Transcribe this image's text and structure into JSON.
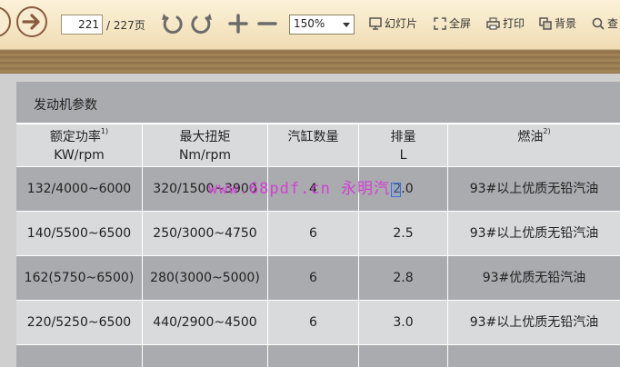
{
  "toolbar": {
    "page_current": "221",
    "page_total": "/ 227页",
    "zoom": "150%",
    "slideshow_label": "幻灯片",
    "fullscreen_label": "全屏",
    "print_label": "打印",
    "background_label": "背景",
    "search_label": "查"
  },
  "table": {
    "title": "发动机参数",
    "headers": [
      {
        "line1": "额定功率",
        "sup": "1)",
        "line2": "KW/rpm"
      },
      {
        "line1": "最大扭矩",
        "sup": "",
        "line2": "Nm/rpm"
      },
      {
        "line1": "汽缸数量",
        "sup": "",
        "line2": ""
      },
      {
        "line1": "排量",
        "sup": "",
        "line2": "L"
      },
      {
        "line1": "燃油",
        "sup": "2)",
        "line2": ""
      }
    ],
    "rows": [
      {
        "power": "132/4000~6000",
        "torque": "320/1500~3900",
        "cylinders": "4",
        "displacement": "2.0",
        "fuel": "93#以上优质无铅汽油"
      },
      {
        "power": "140/5500~6500",
        "torque": "250/3000~4750",
        "cylinders": "6",
        "displacement": "2.5",
        "fuel": "93#以上优质无铅汽油"
      },
      {
        "power": "162(5750~6500)",
        "torque": "280(3000~5000)",
        "cylinders": "6",
        "displacement": "2.8",
        "fuel": "93#优质无铅汽油"
      },
      {
        "power": "220/5250~6500",
        "torque": "440/2900~4500",
        "cylinders": "6",
        "displacement": "3.0",
        "fuel": "93#以上优质无铅汽油"
      }
    ]
  },
  "watermark": "www.68pdf.cn 永明汽",
  "colors": {
    "toolbar_bg": "#f5e6c4",
    "header_dark": "#a9abaf",
    "header_light": "#d9dadc",
    "watermark": "#d23fd2"
  }
}
